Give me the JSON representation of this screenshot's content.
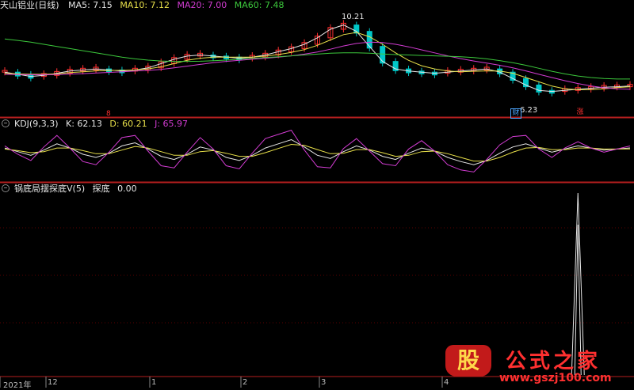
{
  "main_panel": {
    "title": "天山铝业(日线)",
    "ma_labels": [
      {
        "text": "MA5: 7.15",
        "color": "#e6e6e6"
      },
      {
        "text": "MA10: 7.12",
        "color": "#e8e04a"
      },
      {
        "text": "MA20: 7.00",
        "color": "#d23cd2"
      },
      {
        "text": "MA60: 7.48",
        "color": "#3cc83c"
      }
    ],
    "high_annotation": "10.21",
    "low_annotation": "6.23",
    "badges": [
      {
        "text": "8",
        "color": "#ff3030"
      },
      {
        "text": "财",
        "color": "#4da6ff"
      },
      {
        "text": "涨",
        "color": "#ff3030"
      }
    ]
  },
  "kdj_panel": {
    "title": "KDJ(9,3,3)",
    "labels": [
      {
        "text": "K: 62.13",
        "color": "#e6e6e6"
      },
      {
        "text": "D: 60.21",
        "color": "#e8e04a"
      },
      {
        "text": "J: 65.97",
        "color": "#d23cd2"
      }
    ]
  },
  "indicator_panel": {
    "title": "锅底局摆探底V(5)",
    "labels": [
      {
        "text": "探底",
        "color": "#e6e6e6"
      },
      {
        "text": "0.00",
        "color": "#e6e6e6"
      }
    ]
  },
  "x_axis": {
    "labels": [
      "2021年",
      "12",
      "1",
      "2",
      "3",
      "4"
    ]
  },
  "watermark": {
    "logo": "股",
    "name": "公式之家",
    "url": "www.gszj100.com"
  },
  "colors": {
    "up": "#ff3030",
    "down": "#00c8c8",
    "ma5": "#e6e6e6",
    "ma10": "#e8e04a",
    "ma20": "#d23cd2",
    "ma60": "#3cc83c",
    "panel_border": "#b41e1e",
    "grid": "#5a0000"
  },
  "chart_data": [
    {
      "type": "candlestick",
      "title": "天山铝业(日线)",
      "annotations": {
        "high": 10.21,
        "low": 6.23
      },
      "ma": {
        "MA5": 7.15,
        "MA10": 7.12,
        "MA20": 7.0,
        "MA60": 7.48
      },
      "series": [
        {
          "name": "MA5",
          "values": [
            7.8,
            7.7,
            7.6,
            7.65,
            7.75,
            7.85,
            7.9,
            7.95,
            7.9,
            7.85,
            7.9,
            8.0,
            8.2,
            8.4,
            8.55,
            8.6,
            8.55,
            8.5,
            8.45,
            8.5,
            8.6,
            8.75,
            8.9,
            9.1,
            9.4,
            9.8,
            10.0,
            9.7,
            9.0,
            8.3,
            7.95,
            7.85,
            7.8,
            7.75,
            7.8,
            7.85,
            7.9,
            7.95,
            7.8,
            7.5,
            7.2,
            6.95,
            6.9,
            6.95,
            7.0,
            7.05,
            7.1,
            7.12,
            7.15
          ]
        },
        {
          "name": "MA10",
          "values": [
            7.75,
            7.72,
            7.7,
            7.7,
            7.72,
            7.78,
            7.82,
            7.86,
            7.88,
            7.88,
            7.9,
            7.95,
            8.05,
            8.2,
            8.35,
            8.45,
            8.5,
            8.5,
            8.5,
            8.5,
            8.55,
            8.62,
            8.72,
            8.85,
            9.05,
            9.3,
            9.55,
            9.65,
            9.45,
            9.1,
            8.7,
            8.35,
            8.1,
            7.95,
            7.85,
            7.82,
            7.84,
            7.86,
            7.85,
            7.75,
            7.55,
            7.35,
            7.15,
            7.02,
            6.98,
            6.98,
            7.02,
            7.08,
            7.12
          ]
        },
        {
          "name": "MA20",
          "values": [
            7.7,
            7.69,
            7.68,
            7.68,
            7.69,
            7.71,
            7.73,
            7.76,
            7.79,
            7.82,
            7.85,
            7.88,
            7.93,
            8.0,
            8.08,
            8.16,
            8.24,
            8.3,
            8.35,
            8.4,
            8.45,
            8.5,
            8.56,
            8.64,
            8.74,
            8.87,
            9.02,
            9.14,
            9.2,
            9.18,
            9.1,
            8.98,
            8.84,
            8.7,
            8.56,
            8.43,
            8.32,
            8.22,
            8.12,
            8.0,
            7.86,
            7.7,
            7.55,
            7.4,
            7.27,
            7.16,
            7.07,
            7.02,
            7.0
          ]
        },
        {
          "name": "MA60",
          "values": [
            9.35,
            9.28,
            9.2,
            9.1,
            9.0,
            8.9,
            8.8,
            8.7,
            8.6,
            8.5,
            8.42,
            8.36,
            8.32,
            8.3,
            8.3,
            8.31,
            8.33,
            8.36,
            8.4,
            8.44,
            8.48,
            8.52,
            8.56,
            8.6,
            8.64,
            8.68,
            8.7,
            8.7,
            8.68,
            8.65,
            8.62,
            8.6,
            8.58,
            8.56,
            8.54,
            8.52,
            8.48,
            8.42,
            8.34,
            8.24,
            8.12,
            7.98,
            7.84,
            7.72,
            7.62,
            7.55,
            7.5,
            7.48,
            7.48
          ]
        }
      ]
    },
    {
      "type": "line",
      "title": "KDJ(9,3,3)",
      "series": [
        {
          "name": "K",
          "values": [
            62,
            55,
            48,
            58,
            70,
            62,
            50,
            44,
            52,
            66,
            72,
            60,
            46,
            40,
            50,
            64,
            58,
            44,
            38,
            48,
            62,
            70,
            78,
            64,
            48,
            42,
            55,
            66,
            58,
            46,
            40,
            52,
            62,
            56,
            44,
            36,
            30,
            38,
            52,
            64,
            70,
            62,
            54,
            60,
            66,
            62,
            58,
            60,
            62.13
          ]
        },
        {
          "name": "D",
          "values": [
            60,
            57,
            53,
            55,
            62,
            62,
            57,
            51,
            51,
            58,
            65,
            62,
            55,
            48,
            48,
            55,
            57,
            52,
            46,
            46,
            53,
            61,
            69,
            67,
            59,
            51,
            52,
            59,
            59,
            53,
            46,
            48,
            55,
            56,
            51,
            44,
            37,
            37,
            44,
            54,
            62,
            63,
            59,
            59,
            62,
            62,
            60,
            60,
            60.21
          ]
        },
        {
          "name": "J",
          "values": [
            66,
            50,
            38,
            64,
            86,
            62,
            36,
            30,
            54,
            82,
            86,
            56,
            28,
            24,
            54,
            82,
            60,
            28,
            22,
            52,
            80,
            88,
            96,
            58,
            26,
            24,
            61,
            80,
            56,
            32,
            28,
            60,
            76,
            56,
            30,
            20,
            16,
            40,
            68,
            84,
            86,
            60,
            44,
            62,
            74,
            62,
            54,
            60,
            65.97
          ]
        }
      ]
    },
    {
      "type": "line",
      "title": "锅底局摆探底V(5)",
      "series": [
        {
          "name": "探底",
          "values": [
            0,
            0,
            0,
            0,
            0,
            0,
            0,
            0,
            0,
            0,
            0,
            0,
            0,
            0,
            0,
            0,
            0,
            0,
            0,
            0,
            0,
            0,
            0,
            0,
            0,
            0,
            0,
            0,
            0,
            0,
            0,
            0,
            0,
            0,
            0,
            0,
            0,
            0,
            0,
            0,
            0,
            0,
            0,
            0,
            100,
            0,
            0,
            0,
            0.0
          ]
        }
      ]
    }
  ]
}
